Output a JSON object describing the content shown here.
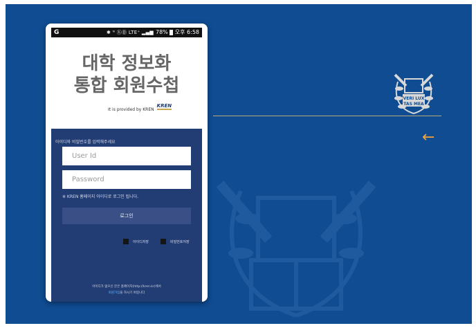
{
  "status_bar": {
    "left_icon": "G",
    "icons_text": "✱ ᴺ ⓗⒹ LTE⁺ ▂▄▆",
    "battery_text": "78%",
    "time": "오후 6:58"
  },
  "title": {
    "line1": "대학 정보화",
    "line2": "통합 회원수첩"
  },
  "provider": {
    "text": "It is provided by KREN",
    "logo_text": "KREN"
  },
  "login": {
    "prompt": "아이디와 비밀번호를 입력해주세요",
    "user_placeholder": "User Id",
    "password_placeholder": "Password",
    "notice": "※ KREN 홈페이지 아이디로 로그인 됩니다.",
    "button_label": "로그인",
    "save_id_label": "아이디저장",
    "save_pw_label": "비밀번호저장",
    "footer_line1": "아이디가 없으신 분은 홈페이지(http://kren.kr)에서",
    "footer_link": "회원가입",
    "footer_line2_rest": "을 하시기 바랍니다"
  },
  "seal": {
    "motto_top": "VERI LUX",
    "motto_bottom": "TAS MEA"
  },
  "colors": {
    "background": "#0f4c92",
    "panel": "#223c74",
    "button": "#3b4f87",
    "accent": "#f2a23a"
  },
  "icons": {
    "back": "arrow-left-icon",
    "seal": "university-seal-icon"
  }
}
